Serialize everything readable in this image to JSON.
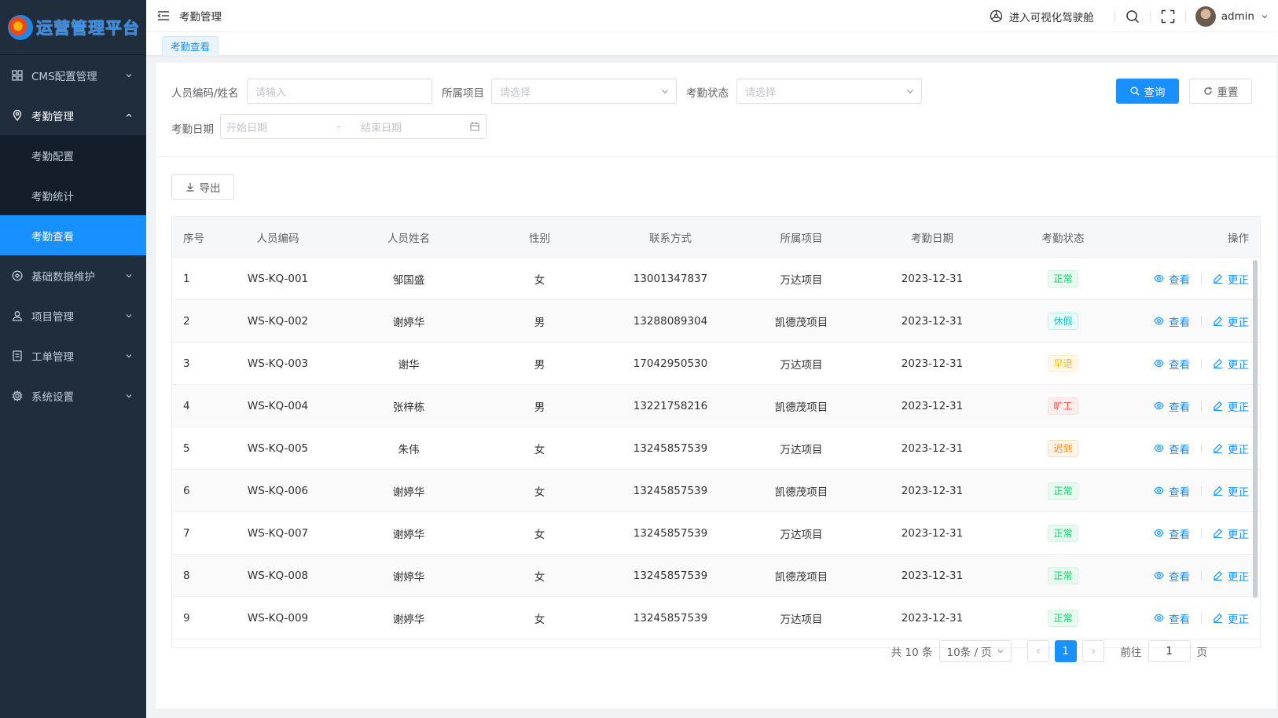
{
  "app": {
    "logo_text": "运营管理平台"
  },
  "sidebar": {
    "items": [
      {
        "label": "CMS配置管理",
        "icon": "grid-icon"
      },
      {
        "label": "考勤管理",
        "icon": "location-icon",
        "open": true,
        "children": [
          {
            "label": "考勤配置"
          },
          {
            "label": "考勤统计"
          },
          {
            "label": "考勤查看",
            "active": true
          }
        ]
      },
      {
        "label": "基础数据维护",
        "icon": "database-icon"
      },
      {
        "label": "项目管理",
        "icon": "person-icon"
      },
      {
        "label": "工单管理",
        "icon": "document-icon"
      },
      {
        "label": "系统设置",
        "icon": "gear-icon"
      }
    ]
  },
  "header": {
    "breadcrumb": "考勤管理",
    "cockpit_link": "进入可视化驾驶舱",
    "username": "admin"
  },
  "tabs": [
    {
      "label": "考勤查看",
      "active": true
    }
  ],
  "filters": {
    "person_label": "人员编码/姓名",
    "person_placeholder": "请输入",
    "project_label": "所属项目",
    "project_placeholder": "请选择",
    "status_label": "考勤状态",
    "status_placeholder": "请选择",
    "date_label": "考勤日期",
    "date_start_placeholder": "开始日期",
    "date_sep": "–",
    "date_end_placeholder": "结束日期",
    "search_button": "查询",
    "reset_button": "重置"
  },
  "toolbar": {
    "export_button": "导出"
  },
  "table": {
    "columns": [
      "序号",
      "人员编码",
      "人员姓名",
      "性别",
      "联系方式",
      "所属项目",
      "考勤日期",
      "考勤状态",
      "操作"
    ],
    "view_label": "查看",
    "edit_label": "更正",
    "rows": [
      {
        "idx": "1",
        "code": "WS-KQ-001",
        "name": "邹国盛",
        "sex": "女",
        "phone": "13001347837",
        "project": "万达项目",
        "date": "2023-12-31",
        "status": "正常",
        "status_type": "success"
      },
      {
        "idx": "2",
        "code": "WS-KQ-002",
        "name": "谢婷华",
        "sex": "男",
        "phone": "13288089304",
        "project": "凯德茂项目",
        "date": "2023-12-31",
        "status": "休假",
        "status_type": "info"
      },
      {
        "idx": "3",
        "code": "WS-KQ-003",
        "name": "谢华",
        "sex": "男",
        "phone": "17042950530",
        "project": "万达项目",
        "date": "2023-12-31",
        "status": "早退",
        "status_type": "warning"
      },
      {
        "idx": "4",
        "code": "WS-KQ-004",
        "name": "张梓栋",
        "sex": "男",
        "phone": "13221758216",
        "project": "凯德茂项目",
        "date": "2023-12-31",
        "status": "旷工",
        "status_type": "danger"
      },
      {
        "idx": "5",
        "code": "WS-KQ-005",
        "name": "朱伟",
        "sex": "女",
        "phone": "13245857539",
        "project": "万达项目",
        "date": "2023-12-31",
        "status": "迟到",
        "status_type": "orange"
      },
      {
        "idx": "6",
        "code": "WS-KQ-006",
        "name": "谢婷华",
        "sex": "女",
        "phone": "13245857539",
        "project": "凯德茂项目",
        "date": "2023-12-31",
        "status": "正常",
        "status_type": "success"
      },
      {
        "idx": "7",
        "code": "WS-KQ-007",
        "name": "谢婷华",
        "sex": "女",
        "phone": "13245857539",
        "project": "万达项目",
        "date": "2023-12-31",
        "status": "正常",
        "status_type": "success"
      },
      {
        "idx": "8",
        "code": "WS-KQ-008",
        "name": "谢婷华",
        "sex": "女",
        "phone": "13245857539",
        "project": "凯德茂项目",
        "date": "2023-12-31",
        "status": "正常",
        "status_type": "success"
      },
      {
        "idx": "9",
        "code": "WS-KQ-009",
        "name": "谢婷华",
        "sex": "女",
        "phone": "13245857539",
        "project": "万达项目",
        "date": "2023-12-31",
        "status": "正常",
        "status_type": "success"
      }
    ]
  },
  "pagination": {
    "total_text": "共 10 条",
    "page_size": "10条 / 页",
    "current_page": "1",
    "goto_label": "前往",
    "goto_value": "1",
    "page_suffix": "页"
  },
  "colors": {
    "primary": "#1890ff",
    "sidebar_bg": "#1f2d3d",
    "success": "#13ce66",
    "info": "#13c2c2",
    "warning": "#ffba00",
    "danger": "#ff4949",
    "orange": "#fa8c16"
  }
}
